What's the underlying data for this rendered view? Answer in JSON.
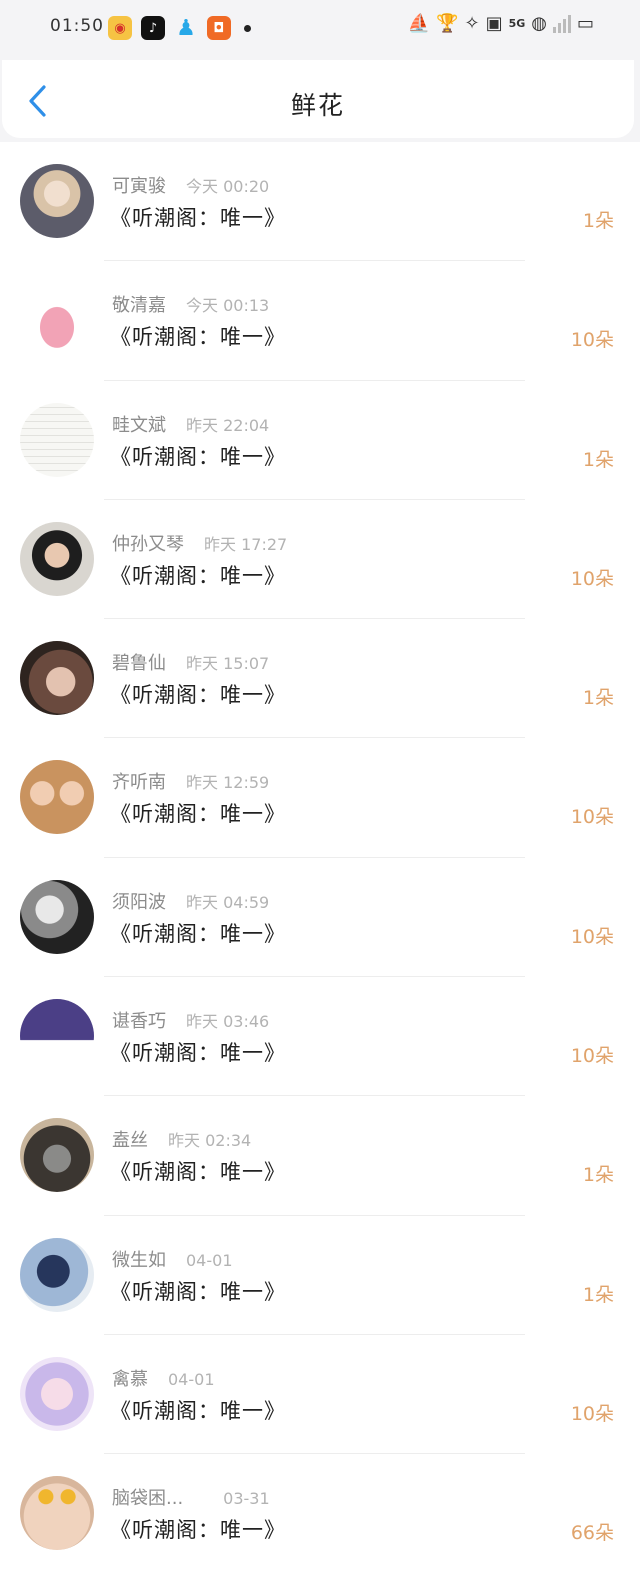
{
  "status_bar": {
    "time": "01:50",
    "network": "5G",
    "app_icons": [
      "weibo-icon",
      "tiktok-icon",
      "qq-icon",
      "mango-icon"
    ]
  },
  "header": {
    "title": "鲜花",
    "back_icon": "chevron-left-icon"
  },
  "colors": {
    "accent": "#2f8fe8",
    "count": "#e0a36b"
  },
  "rows": [
    {
      "name": "可寅骏",
      "time": "今天 00:20",
      "work": "《听潮阁：唯一》",
      "count": "1朵"
    },
    {
      "name": "敬清嘉",
      "time": "今天 00:13",
      "work": "《听潮阁：唯一》",
      "count": "10朵"
    },
    {
      "name": "畦文斌",
      "time": "昨天 22:04",
      "work": "《听潮阁：唯一》",
      "count": "1朵"
    },
    {
      "name": "仲孙又琴",
      "time": "昨天 17:27",
      "work": "《听潮阁：唯一》",
      "count": "10朵"
    },
    {
      "name": "碧鲁仙",
      "time": "昨天 15:07",
      "work": "《听潮阁：唯一》",
      "count": "1朵"
    },
    {
      "name": "齐听南",
      "time": "昨天 12:59",
      "work": "《听潮阁：唯一》",
      "count": "10朵"
    },
    {
      "name": "须阳波",
      "time": "昨天 04:59",
      "work": "《听潮阁：唯一》",
      "count": "10朵"
    },
    {
      "name": "谌香巧",
      "time": "昨天 03:46",
      "work": "《听潮阁：唯一》",
      "count": "10朵"
    },
    {
      "name": "盍丝",
      "time": "昨天 02:34",
      "work": "《听潮阁：唯一》",
      "count": "1朵"
    },
    {
      "name": "微生如",
      "time": "04-01",
      "work": "《听潮阁：唯一》",
      "count": "1朵"
    },
    {
      "name": "禽慕",
      "time": "04-01",
      "work": "《听潮阁：唯一》",
      "count": "10朵"
    },
    {
      "name": "脑袋困...",
      "time": "03-31",
      "work": "《听潮阁：唯一》",
      "count": "66朵"
    }
  ]
}
